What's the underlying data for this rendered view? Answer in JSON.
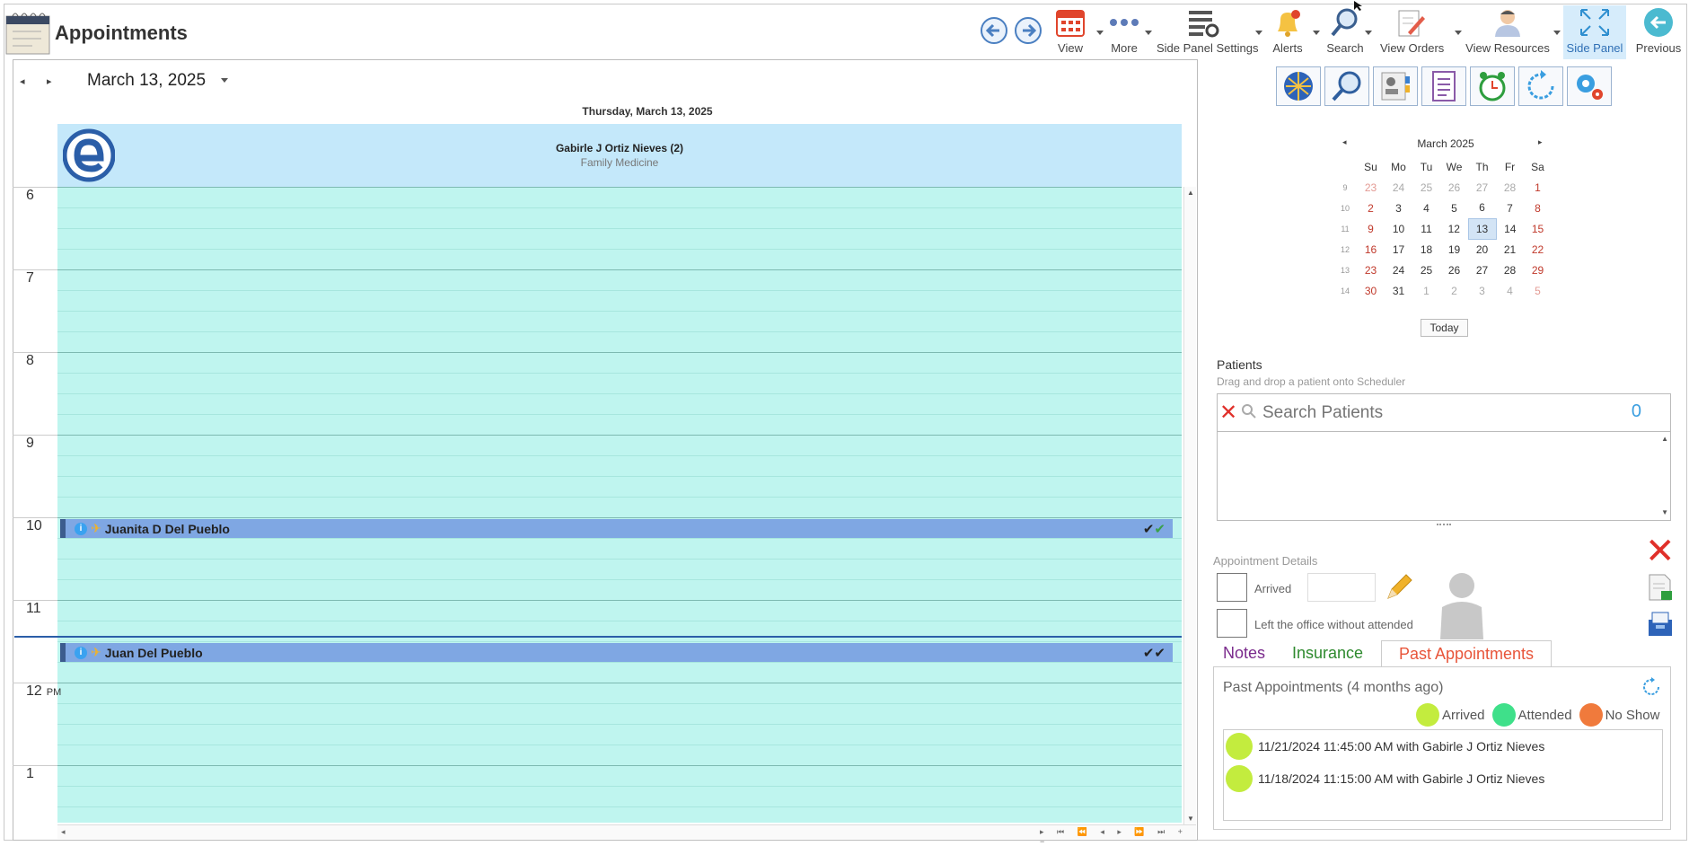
{
  "app": {
    "title": "Appointments"
  },
  "toolbar": {
    "view": "View",
    "more": "More",
    "side_panel_settings": "Side Panel Settings",
    "alerts": "Alerts",
    "search": "Search",
    "view_orders": "View Orders",
    "view_resources": "View Resources",
    "side_panel": "Side Panel",
    "previous": "Previous"
  },
  "scheduler": {
    "date": "March 13, 2025",
    "day_header": "Thursday, March 13, 2025",
    "provider_name": "Gabirle J Ortiz Nieves (2)",
    "provider_specialty": "Family Medicine",
    "hours": [
      "6",
      "7",
      "8",
      "9",
      "10",
      "11",
      "12",
      "1"
    ],
    "pm_label": "PM",
    "appointments": [
      {
        "name": "Juanita D Del Pueblo",
        "info_icon": "i"
      },
      {
        "name": "Juan Del Pueblo",
        "info_icon": "i"
      }
    ]
  },
  "calendar": {
    "month_title": "March 2025",
    "days": [
      "Su",
      "Mo",
      "Tu",
      "We",
      "Th",
      "Fr",
      "Sa"
    ],
    "weeks": [
      {
        "wk": "9",
        "d": [
          "23",
          "24",
          "25",
          "26",
          "27",
          "28",
          "1"
        ]
      },
      {
        "wk": "10",
        "d": [
          "2",
          "3",
          "4",
          "5",
          "6",
          "7",
          "8"
        ]
      },
      {
        "wk": "11",
        "d": [
          "9",
          "10",
          "11",
          "12",
          "13",
          "14",
          "15"
        ]
      },
      {
        "wk": "12",
        "d": [
          "16",
          "17",
          "18",
          "19",
          "20",
          "21",
          "22"
        ]
      },
      {
        "wk": "13",
        "d": [
          "23",
          "24",
          "25",
          "26",
          "27",
          "28",
          "29"
        ]
      },
      {
        "wk": "14",
        "d": [
          "30",
          "31",
          "1",
          "2",
          "3",
          "4",
          "5"
        ]
      }
    ],
    "selected": "13",
    "today_label": "Today"
  },
  "patients": {
    "title": "Patients",
    "subtitle": "Drag and drop a patient onto Scheduler",
    "search_placeholder": "Search Patients",
    "count": "0"
  },
  "details": {
    "title": "Appointment Details",
    "arrived": "Arrived",
    "left_office": "Left the office without attended",
    "tabs": {
      "notes": "Notes",
      "insurance": "Insurance",
      "past": "Past Appointments"
    }
  },
  "past": {
    "heading": "Past Appointments (4 months ago)",
    "legend": {
      "arrived": "Arrived",
      "attended": "Attended",
      "no_show": "No Show"
    },
    "items": [
      "11/21/2024 11:45:00 AM with Gabirle J Ortiz Nieves",
      "11/18/2024 11:15:00 AM with Gabirle J Ortiz Nieves"
    ]
  },
  "colors": {
    "slot": "#bff5ef",
    "header": "#c4e8fa",
    "appointment": "#7fa7e3",
    "arrived": "#c3ec3e",
    "attended": "#3fe08a",
    "no_show": "#f07a3c"
  }
}
